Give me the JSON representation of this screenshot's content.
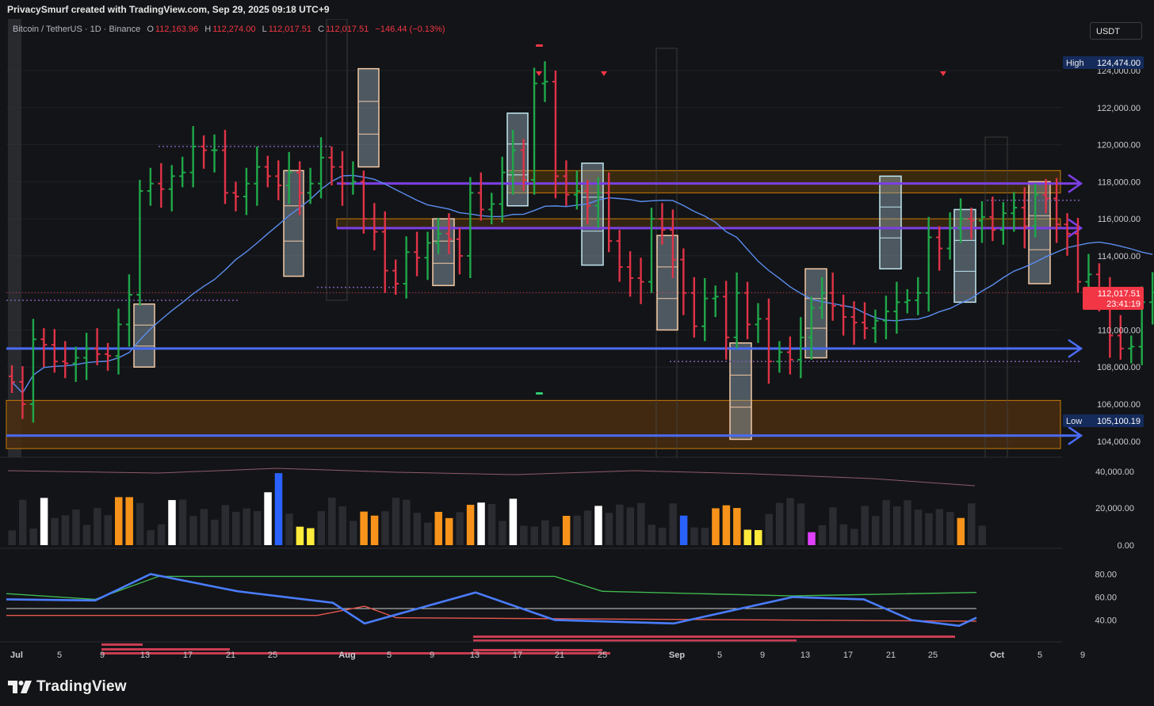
{
  "header": {
    "attribution": "PrivacySmurf created with TradingView.com, Sep 29, 2025 09:18 UTC+9",
    "currency_button": "USDT"
  },
  "legend": {
    "symbol": "Bitcoin / TetherUS · 1D · Binance",
    "o_label": "O",
    "o_value": "112,163.96",
    "h_label": "H",
    "h_value": "112,274.00",
    "l_label": "L",
    "l_value": "112,017.51",
    "c_label": "C",
    "c_value": "112,017.51",
    "change": "−146.44 (−0.13%)"
  },
  "price_axis": {
    "ticks": [
      "124,000.00",
      "122,000.00",
      "120,000.00",
      "118,000.00",
      "116,000.00",
      "114,000.00",
      "112,000.00",
      "110,000.00",
      "108,000.00",
      "106,000.00",
      "104,000.00"
    ],
    "high_label": "High",
    "high_value": "124,474.00",
    "low_label": "Low",
    "low_value": "105,100.19",
    "current_price": "112,017.51",
    "countdown": "23:41:19"
  },
  "volume_axis": {
    "ticks": [
      "40,000.00",
      "20,000.00",
      "0.00"
    ]
  },
  "osc_axis": {
    "ticks": [
      "80.00",
      "60.00",
      "40.00"
    ]
  },
  "time_axis": {
    "ticks": [
      "Jul",
      "5",
      "9",
      "13",
      "17",
      "21",
      "25",
      "Aug",
      "5",
      "9",
      "13",
      "17",
      "21",
      "25",
      "Sep",
      "5",
      "9",
      "13",
      "17",
      "21",
      "25",
      "Oct",
      "5",
      "9"
    ]
  },
  "footer": {
    "brand": "TradingView"
  },
  "colors": {
    "up": "#26a69a",
    "up_candle": "#1fa84a",
    "down": "#e03347",
    "ma": "#5b8def",
    "level_blue": "#4a6cf7",
    "level_purple": "#7b3fe4",
    "zone": "#c97b0a"
  },
  "chart_data": {
    "type": "candlestick",
    "title": "Bitcoin / TetherUS · 1D · Binance",
    "x_start": "2025-07-01",
    "ylim": [
      103500,
      125000
    ],
    "candles_approx_close": [
      107200,
      106000,
      109500,
      109200,
      108300,
      108200,
      108500,
      109000,
      108700,
      108600,
      110300,
      111900,
      117500,
      117900,
      117600,
      118300,
      118500,
      119900,
      119700,
      119700,
      117400,
      117200,
      117900,
      118800,
      118300,
      117800,
      118500,
      117400,
      117900,
      119300,
      118800,
      117900,
      118000,
      116000,
      115300,
      113200,
      112500,
      114200,
      113900,
      114700,
      115200,
      114900,
      114000,
      117400,
      116500,
      116800,
      118500,
      119700,
      118100,
      123300,
      123400,
      118300,
      117300,
      117500,
      116700,
      117400,
      114800,
      113400,
      112800,
      112600,
      116000,
      115400,
      113800,
      112000,
      110200,
      111700,
      111800,
      109600,
      112000,
      110300,
      110600,
      108300,
      108800,
      108400,
      109600,
      111200,
      112000,
      111300,
      110700,
      110400,
      110100,
      110500,
      111000,
      111500,
      111600,
      112000,
      115000,
      114400,
      115500,
      116000,
      115900,
      116100,
      115400,
      116300,
      116600,
      115600,
      117300,
      117100,
      115700,
      115200,
      112600,
      113000,
      112000,
      109700,
      109000,
      109100,
      111500,
      112017
    ]
  }
}
